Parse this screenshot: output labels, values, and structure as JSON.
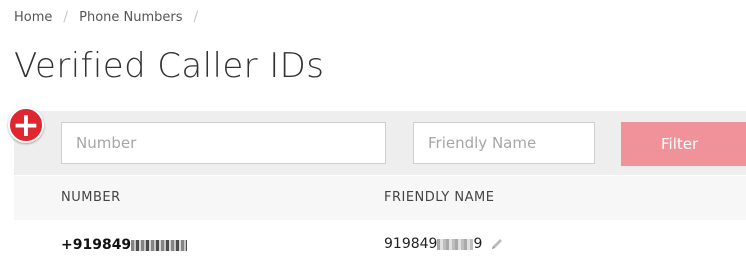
{
  "breadcrumb": {
    "items": [
      "Home",
      "Phone Numbers"
    ],
    "separator": "/"
  },
  "page": {
    "title": "Verified Caller IDs"
  },
  "add_button": {
    "icon": "plus-icon",
    "color": "#e0262f",
    "label": "+"
  },
  "filter": {
    "number_placeholder": "Number",
    "friendly_name_placeholder": "Friendly Name",
    "button_label": "Filter",
    "button_color": "#ef929a"
  },
  "table": {
    "columns": [
      "NUMBER",
      "FRIENDLY NAME"
    ],
    "rows": [
      {
        "number_visible": "+919849",
        "number_redacted_end": "9",
        "friendly_visible": "919849",
        "friendly_redacted_end": "9",
        "edit_icon": "pencil-icon"
      }
    ]
  }
}
